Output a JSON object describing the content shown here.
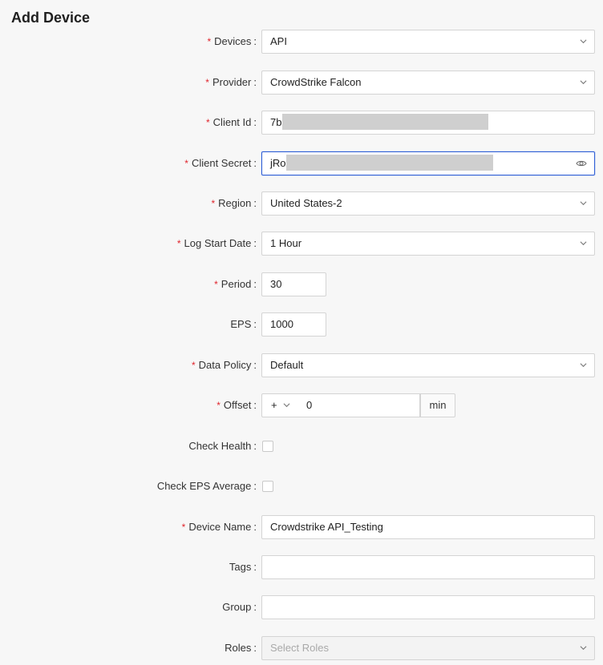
{
  "page": {
    "title": "Add Device"
  },
  "fields": {
    "devices": {
      "label": "Devices",
      "required": true,
      "value": "API"
    },
    "provider": {
      "label": "Provider",
      "required": true,
      "value": "CrowdStrike Falcon"
    },
    "client_id": {
      "label": "Client Id",
      "required": true,
      "value_visible": "7b"
    },
    "client_secret": {
      "label": "Client Secret",
      "required": true,
      "value_visible": "jRo("
    },
    "region": {
      "label": "Region",
      "required": true,
      "value": "United States-2"
    },
    "log_start_date": {
      "label": "Log Start Date",
      "required": true,
      "value": "1 Hour"
    },
    "period": {
      "label": "Period",
      "required": true,
      "value": "30"
    },
    "eps": {
      "label": "EPS",
      "required": false,
      "value": "1000"
    },
    "data_policy": {
      "label": "Data Policy",
      "required": true,
      "value": "Default"
    },
    "offset": {
      "label": "Offset",
      "required": true,
      "sign": "+",
      "value": "0",
      "unit": "min"
    },
    "check_health": {
      "label": "Check Health",
      "required": false,
      "checked": false
    },
    "check_eps_average": {
      "label": "Check EPS Average",
      "required": false,
      "checked": false
    },
    "device_name": {
      "label": "Device Name",
      "required": true,
      "value": "Crowdstrike API_Testing"
    },
    "tags": {
      "label": "Tags",
      "required": false,
      "value": ""
    },
    "group": {
      "label": "Group",
      "required": false,
      "value": ""
    },
    "roles": {
      "label": "Roles",
      "required": false,
      "placeholder": "Select Roles"
    }
  },
  "symbols": {
    "required_mark": "*",
    "colon": ":"
  },
  "colors": {
    "required": "#e0242c",
    "focus_border": "#2f5fd6"
  },
  "icons": {
    "dropdown": "chevron-down-icon",
    "reveal": "eye-icon"
  }
}
